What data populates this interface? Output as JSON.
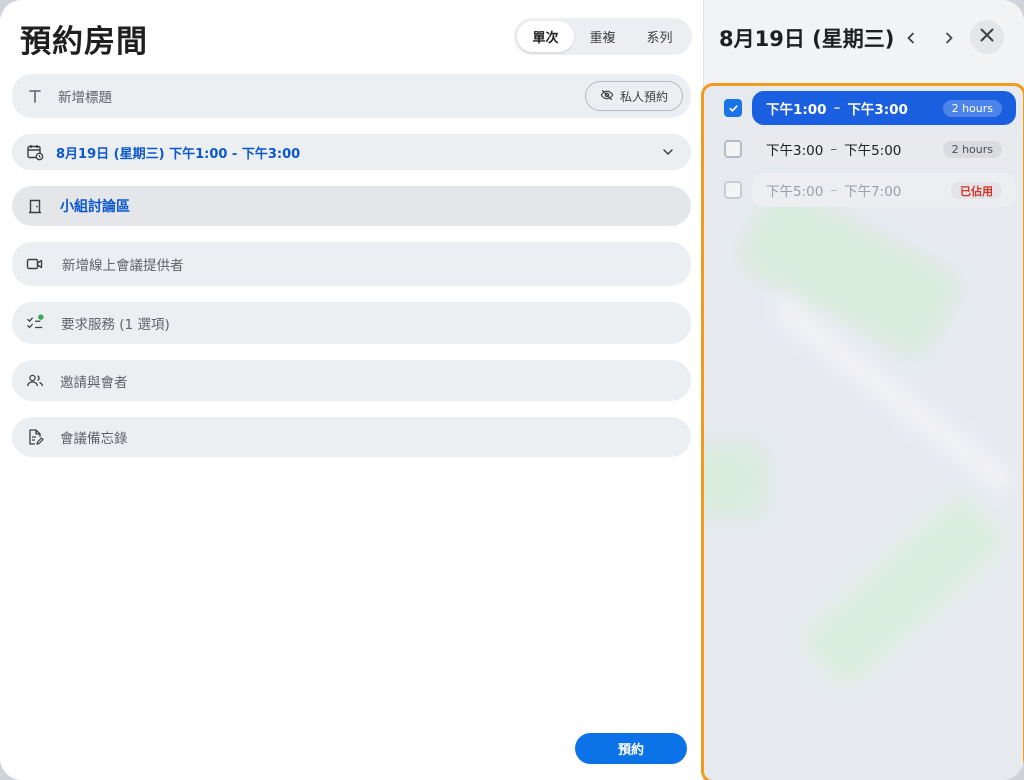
{
  "dialog": {
    "title": "預約房間",
    "recurrence_tabs": [
      {
        "label": "單次",
        "active": true
      },
      {
        "label": "重複",
        "active": false
      },
      {
        "label": "系列",
        "active": false
      }
    ]
  },
  "form": {
    "title_placeholder": "新增標題",
    "private_label": "私人預約",
    "datetime_text": "8月19日 (星期三) 下午1:00 - 下午3:00",
    "room_name": "小組討論區",
    "online_meeting_label": "新增線上會議提供者",
    "services_label": "要求服務 (1 選項)",
    "invite_label": "邀請與會者",
    "notes_label": "會議備忘錄",
    "book_button": "預約"
  },
  "side": {
    "date_heading": "8月19日 (星期三)",
    "slots": [
      {
        "start": "下午1:00",
        "end": "下午3:00",
        "badge": "2 hours",
        "state": "selected",
        "checked": true
      },
      {
        "start": "下午3:00",
        "end": "下午5:00",
        "badge": "2 hours",
        "state": "free",
        "checked": false
      },
      {
        "start": "下午5:00",
        "end": "下午7:00",
        "badge": "已佔用",
        "state": "busy",
        "checked": false
      }
    ],
    "dash": "–"
  },
  "colors": {
    "accent": "#1a5fe0",
    "book_button": "#0b72e7",
    "highlight_border": "#f29b1d",
    "busy_text": "#d93025",
    "status_dot": "#34a853"
  },
  "icons": [
    "title-icon",
    "eye-off-icon",
    "calendar-clock-icon",
    "chevron-down-icon",
    "door-icon",
    "video-icon",
    "checklist-icon",
    "people-icon",
    "note-edit-icon",
    "chevron-left-icon",
    "chevron-right-icon",
    "close-icon",
    "check-icon"
  ]
}
